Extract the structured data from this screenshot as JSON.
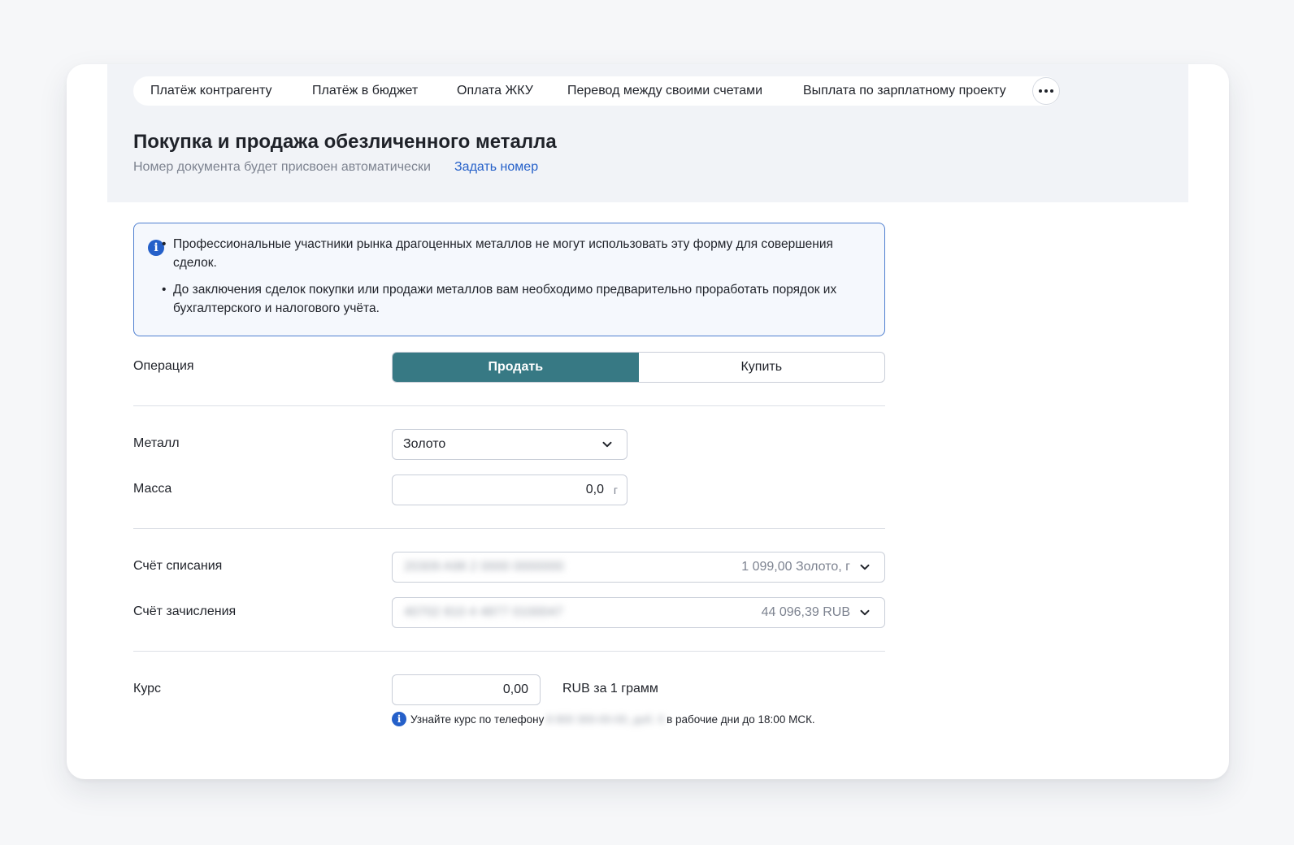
{
  "tabs": [
    {
      "label": "Платёж контрагенту"
    },
    {
      "label": "Платёж в бюджет"
    },
    {
      "label": "Оплата ЖКУ"
    },
    {
      "label": "Перевод между своими счетами"
    },
    {
      "label": "Выплата по зарплатному проекту"
    }
  ],
  "more_icon": "ellipsis-icon",
  "page": {
    "title": "Покупка и продажа обезличенного металла",
    "subtitle": "Номер документа будет присвоен автоматически",
    "set_number_link": "Задать номер"
  },
  "notice": {
    "icon": "info-icon",
    "items": [
      "Профессиональные участники рынка драгоценных металлов не могут использовать эту форму для совершения сделок.",
      "До заключения сделок покупки или продажи металлов вам необходимо предварительно проработать порядок их бухгалтерского и налогового учёта."
    ]
  },
  "form": {
    "operation": {
      "label": "Операция",
      "options": [
        "Продать",
        "Купить"
      ],
      "selected": "Продать"
    },
    "metal": {
      "label": "Металл",
      "value": "Золото"
    },
    "mass": {
      "label": "Масса",
      "value": "0,0",
      "unit": "г"
    },
    "debit_account": {
      "label": "Счёт списания",
      "number": "20309 A98 2 0000 0000000",
      "balance": "1 099,00 Золото, г"
    },
    "credit_account": {
      "label": "Счёт зачисления",
      "number": "40702 810 4 4877 0100047",
      "balance": "44 096,39 RUB"
    },
    "rate": {
      "label": "Курс",
      "value": "0,00",
      "unit": "RUB за 1 грамм",
      "hint_before": "Узнайте курс по телефону",
      "hint_phone": "8 800 300-00-00, доб. 0",
      "hint_after": "в рабочие дни до 18:00 МСК."
    }
  },
  "colors": {
    "accent": "#377984",
    "link": "#2560c9",
    "notice_border": "#4f7fd0"
  }
}
